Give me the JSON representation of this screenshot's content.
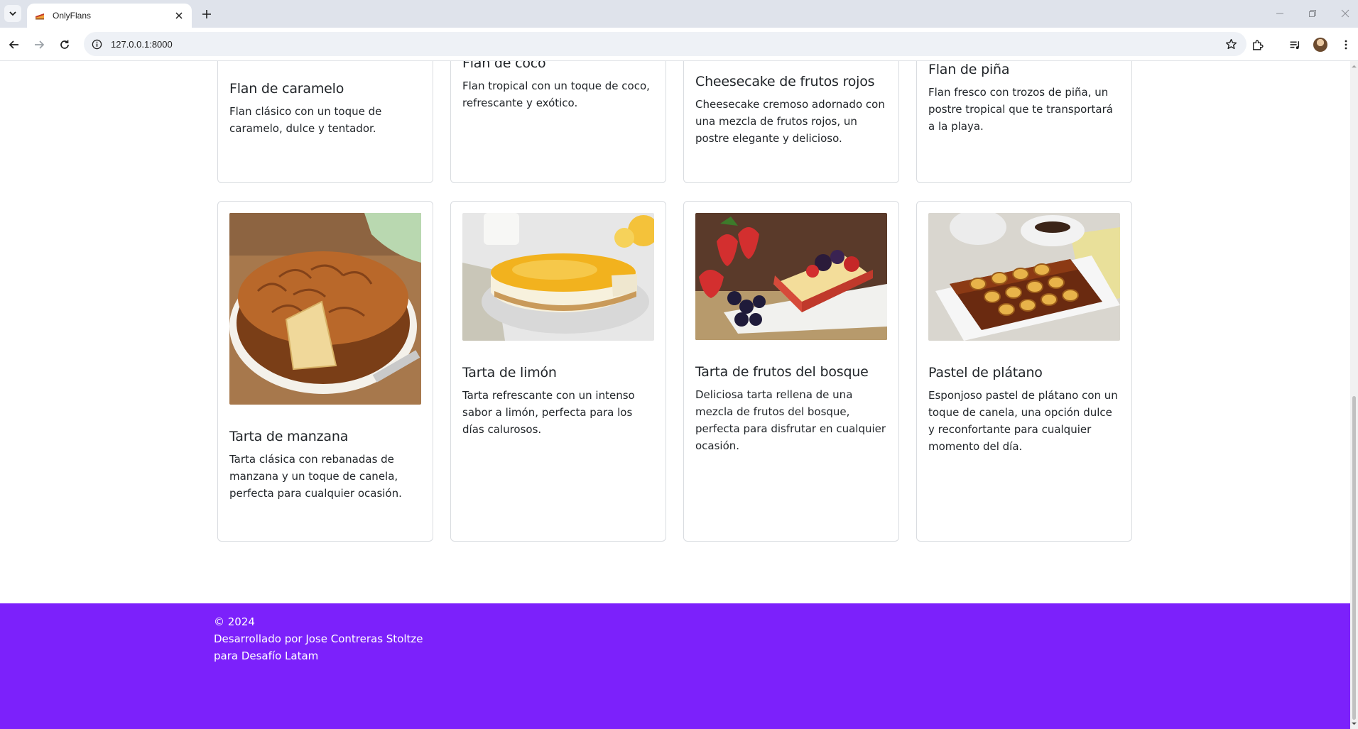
{
  "browser": {
    "tab_title": "OnlyFlans",
    "url": "127.0.0.1:8000"
  },
  "cards_top": [
    {
      "title": "Flan de caramelo",
      "description": "Flan clásico con un toque de caramelo, dulce y tentador."
    },
    {
      "title": "Flan de coco",
      "description": "Flan tropical con un toque de coco, refrescante y exótico."
    },
    {
      "title": "Cheesecake de frutos rojos",
      "description": "Cheesecake cremoso adornado con una mezcla de frutos rojos, un postre elegante y delicioso."
    },
    {
      "title": "Flan de piña",
      "description": "Flan fresco con trozos de piña, un postre tropical que te transportará a la playa."
    }
  ],
  "cards_bottom": [
    {
      "title": "Tarta de manzana",
      "description": "Tarta clásica con rebanadas de manzana y un toque de canela, perfecta para cualquier ocasión.",
      "image": "apple-tart-photo"
    },
    {
      "title": "Tarta de limón",
      "description": "Tarta refrescante con un intenso sabor a limón, perfecta para los días calurosos.",
      "image": "lemon-tart-photo"
    },
    {
      "title": "Tarta de frutos del bosque",
      "description": "Deliciosa tarta rellena de una mezcla de frutos del bosque, perfecta para disfrutar en cualquier ocasión.",
      "image": "berry-tart-photo"
    },
    {
      "title": "Pastel de plátano",
      "description": "Esponjoso pastel de plátano con un toque de canela, una opción dulce y reconfortante para cualquier momento del día.",
      "image": "banana-cake-photo"
    }
  ],
  "footer": {
    "copyright": "© 2024",
    "line1": "Desarrollado por Jose Contreras Stoltze",
    "line2": "para Desafío Latam"
  },
  "colors": {
    "footer_bg": "#7c21fb",
    "card_border": "#d9dce0"
  }
}
